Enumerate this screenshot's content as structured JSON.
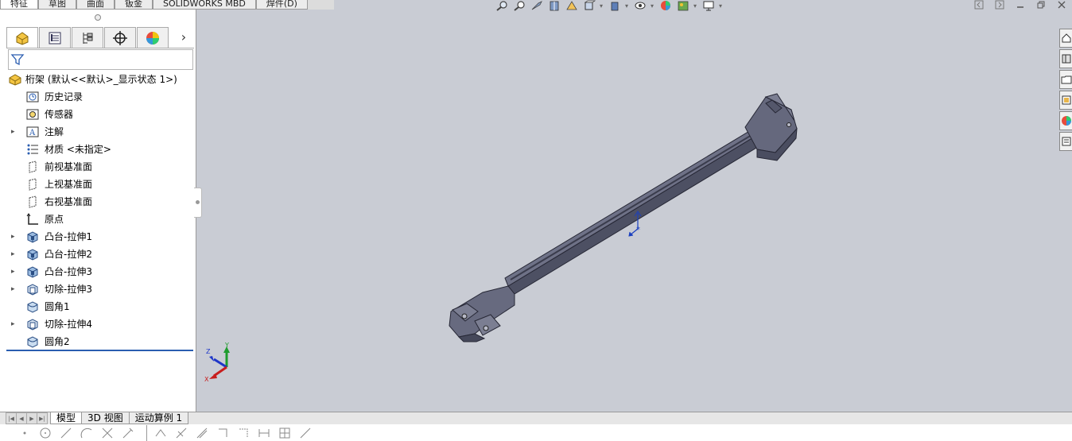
{
  "top_tabs": [
    {
      "label": "特征",
      "active": true
    },
    {
      "label": "草图",
      "active": false
    },
    {
      "label": "曲面",
      "active": false
    },
    {
      "label": "钣金",
      "active": false
    },
    {
      "label": "SOLIDWORKS MBD",
      "active": false
    },
    {
      "label": "焊件(D)",
      "active": false
    }
  ],
  "view_toolbar": {
    "icons": [
      "zoom-to-fit-icon",
      "zoom-to-area-icon",
      "previous-view-icon",
      "section-view-icon",
      "dynamic-annotation-icon",
      "view-orientation-icon",
      "display-style-icon",
      "hide-show-items-icon",
      "edit-appearance-icon",
      "apply-scene-icon",
      "view-settings-icon"
    ]
  },
  "window_controls": [
    "restore-panel-icon",
    "expand-panel-icon",
    "minimize-icon",
    "restore-icon",
    "close-icon"
  ],
  "panel_tabs": [
    "feature-manager-icon",
    "property-manager-icon",
    "configuration-manager-icon",
    "dimxpert-manager-icon",
    "display-manager-icon"
  ],
  "feature_tree": {
    "root": {
      "label": "桁架  (默认<<默认>_显示状态 1>)",
      "icon": "part-icon"
    },
    "items": [
      {
        "label": "历史记录",
        "icon": "history-icon",
        "expandable": false
      },
      {
        "label": "传感器",
        "icon": "sensors-icon",
        "expandable": false
      },
      {
        "label": "注解",
        "icon": "annotations-icon",
        "expandable": true
      },
      {
        "label": "材质 <未指定>",
        "icon": "material-icon",
        "expandable": false
      },
      {
        "label": "前视基准面",
        "icon": "plane-icon",
        "expandable": false
      },
      {
        "label": "上视基准面",
        "icon": "plane-icon",
        "expandable": false
      },
      {
        "label": "右视基准面",
        "icon": "plane-icon",
        "expandable": false
      },
      {
        "label": "原点",
        "icon": "origin-icon",
        "expandable": false
      },
      {
        "label": "凸台-拉伸1",
        "icon": "boss-extrude-icon",
        "expandable": true
      },
      {
        "label": "凸台-拉伸2",
        "icon": "boss-extrude-icon",
        "expandable": true
      },
      {
        "label": "凸台-拉伸3",
        "icon": "boss-extrude-icon",
        "expandable": true
      },
      {
        "label": "切除-拉伸3",
        "icon": "cut-extrude-icon",
        "expandable": true
      },
      {
        "label": "圆角1",
        "icon": "fillet-icon",
        "expandable": false
      },
      {
        "label": "切除-拉伸4",
        "icon": "cut-extrude-icon",
        "expandable": true
      },
      {
        "label": "圆角2",
        "icon": "fillet-icon",
        "expandable": false
      }
    ]
  },
  "task_pane": [
    "solidworks-resources-icon",
    "design-library-icon",
    "file-explorer-icon",
    "view-palette-icon",
    "appearances-icon",
    "custom-properties-icon"
  ],
  "bottom_tabs": [
    {
      "label": "模型",
      "active": true
    },
    {
      "label": "3D 视图",
      "active": false
    },
    {
      "label": "运动算例 1",
      "active": false
    }
  ],
  "triad": {
    "x": "X",
    "y": "Y",
    "z": "Z"
  },
  "colors": {
    "part_fill": "#6c6f84",
    "part_edge": "#2b2c38",
    "viewport_bg": "#c9ccd4",
    "selection_blue": "#2a5db0"
  }
}
